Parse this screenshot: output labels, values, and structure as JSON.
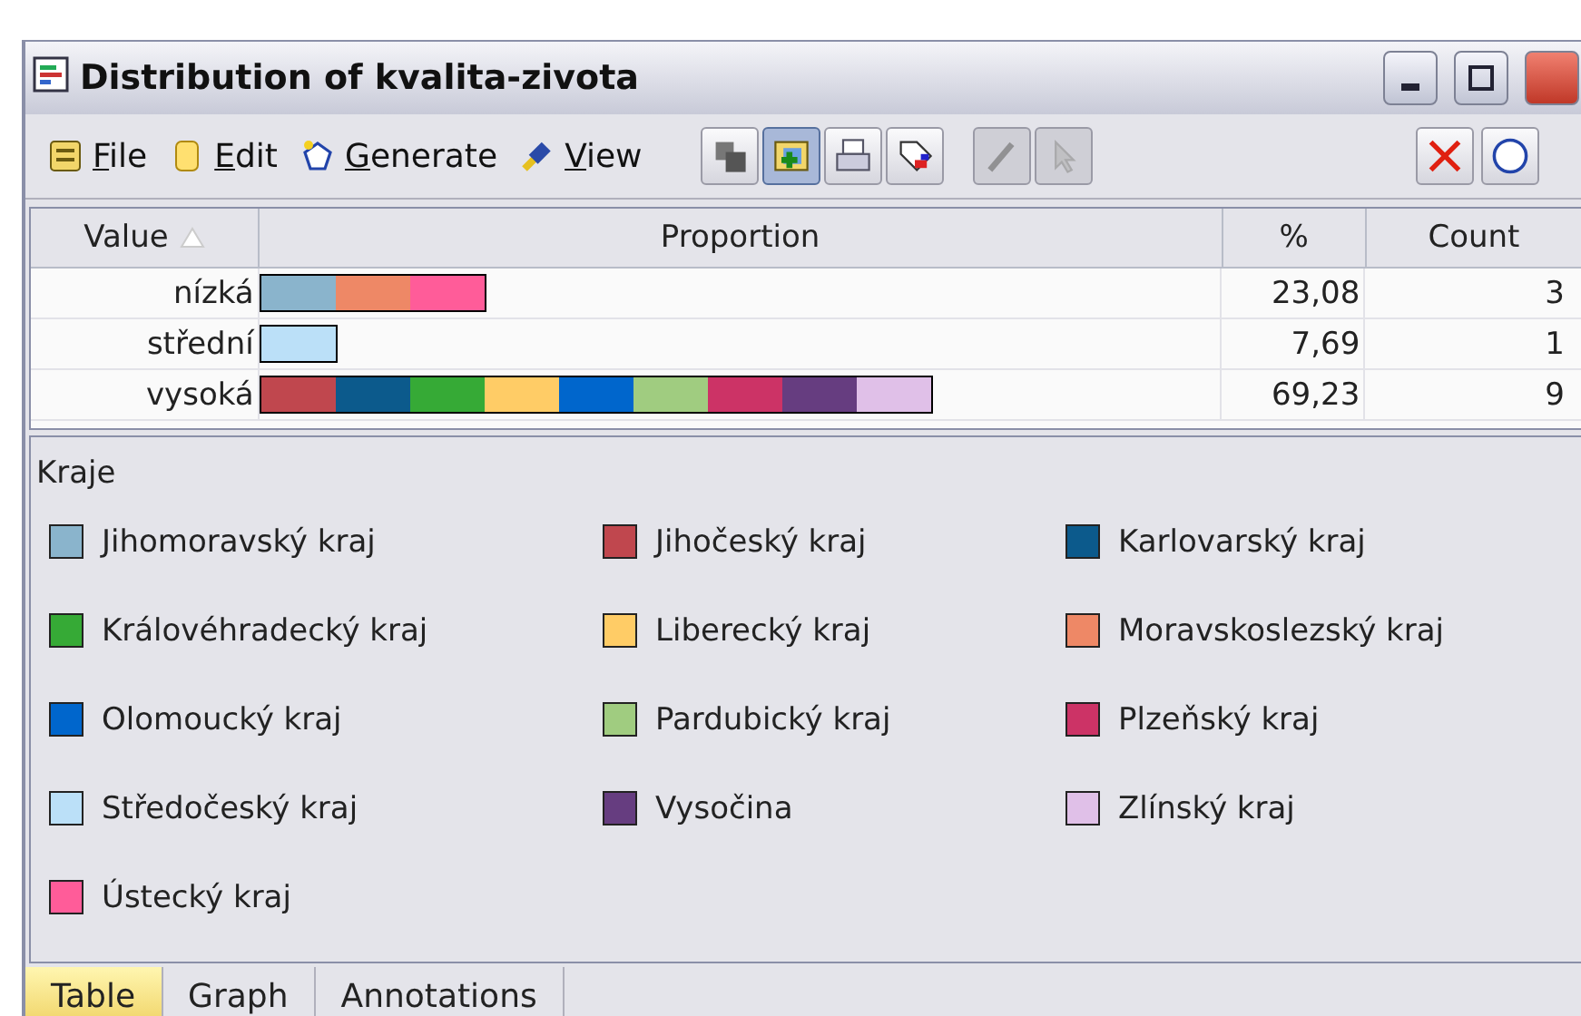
{
  "window": {
    "title": "Distribution of kvalita-zivota"
  },
  "menu": [
    {
      "label": "File",
      "kind": "file"
    },
    {
      "label": "Edit",
      "kind": "edit"
    },
    {
      "label": "Generate",
      "kind": "generate"
    },
    {
      "label": "View",
      "kind": "view"
    }
  ],
  "toolbar": [
    {
      "kind": "stack",
      "selected": false,
      "disabled": false
    },
    {
      "kind": "addnode",
      "selected": true,
      "disabled": false
    },
    {
      "kind": "print",
      "selected": false,
      "disabled": false
    },
    {
      "kind": "tag",
      "selected": false,
      "disabled": false
    },
    {
      "kind": "brush",
      "selected": false,
      "disabled": true
    },
    {
      "kind": "pointer",
      "selected": false,
      "disabled": true
    }
  ],
  "table": {
    "columns": [
      "Value",
      "Proportion",
      "%",
      "Count"
    ],
    "rows": [
      {
        "value": "nízká",
        "segments": [
          {
            "color": "#8ab4cc"
          },
          {
            "color": "#ee8866"
          },
          {
            "color": "#ff5c99"
          }
        ],
        "percent": "23,08",
        "count": "3"
      },
      {
        "value": "střední",
        "segments": [
          {
            "color": "#bbe0f8"
          }
        ],
        "percent": "7,69",
        "count": "1"
      },
      {
        "value": "vysoká",
        "segments": [
          {
            "color": "#c0474e"
          },
          {
            "color": "#0c5a8c"
          },
          {
            "color": "#36aa36"
          },
          {
            "color": "#ffcc66"
          },
          {
            "color": "#0066cc"
          },
          {
            "color": "#a0cc80"
          },
          {
            "color": "#cc3366"
          },
          {
            "color": "#663d80"
          },
          {
            "color": "#e0c0e8"
          }
        ],
        "percent": "69,23",
        "count": "9"
      }
    ]
  },
  "legend": {
    "title": "Kraje",
    "items": [
      {
        "label": "Jihomoravský kraj",
        "color": "#8ab4cc"
      },
      {
        "label": "Jihočeský kraj",
        "color": "#c0474e"
      },
      {
        "label": "Karlovarský kraj",
        "color": "#0c5a8c"
      },
      {
        "label": "Královéhradecký kraj",
        "color": "#36aa36"
      },
      {
        "label": "Liberecký kraj",
        "color": "#ffcc66"
      },
      {
        "label": "Moravskoslezský kraj",
        "color": "#ee8866"
      },
      {
        "label": "Olomoucký kraj",
        "color": "#0066cc"
      },
      {
        "label": "Pardubický kraj",
        "color": "#a0cc80"
      },
      {
        "label": "Plzeňský kraj",
        "color": "#cc3366"
      },
      {
        "label": "Středočeský kraj",
        "color": "#bbe0f8"
      },
      {
        "label": "Vysočina",
        "color": "#663d80"
      },
      {
        "label": "Zlínský kraj",
        "color": "#e0c0e8"
      },
      {
        "label": "Ústecký kraj",
        "color": "#ff5c99"
      }
    ]
  },
  "tabs": [
    {
      "label": "Table",
      "selected": true
    },
    {
      "label": "Graph",
      "selected": false
    },
    {
      "label": "Annotations",
      "selected": false
    }
  ]
}
